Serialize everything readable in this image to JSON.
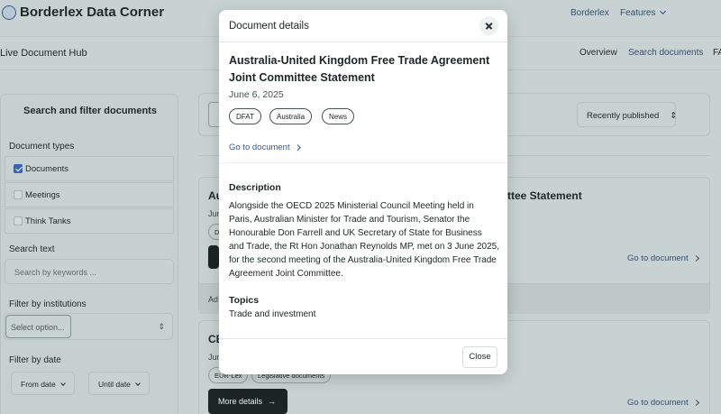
{
  "app": {
    "brand": "Borderlex Data Corner"
  },
  "topnav": {
    "link_borderlex": "Borderlex",
    "link_features": "Features"
  },
  "hub": {
    "title": "Live Document Hub",
    "overview": "Overview",
    "search_documents": "Search documents",
    "fa": "FA"
  },
  "sidebar": {
    "heading": "Search and filter documents",
    "types_label": "Document types",
    "types": [
      {
        "label": "Documents",
        "checked": true
      },
      {
        "label": "Meetings",
        "checked": false
      },
      {
        "label": "Think Tanks",
        "checked": false
      }
    ],
    "search_label": "Search text",
    "search_placeholder": "Search by keywords ...",
    "institutions_label": "Filter by institutions",
    "institutions_placeholder": "Select option...",
    "date_label": "Filter by date",
    "from_date": "From date",
    "until_date": "Until date"
  },
  "results": {
    "sort_label": "Recently published",
    "card1": {
      "title_start": "Au",
      "title_end": "ttee Statement",
      "date_start": "Jun",
      "tag_start": "D",
      "footer_start": "Ad",
      "goto": "Go to document"
    },
    "card2": {
      "title_start": "CE",
      "date_start": "Jun",
      "tags": [
        "EUR-Lex",
        "Legislative documents"
      ],
      "more_details": "More details",
      "goto": "Go to document"
    }
  },
  "modal": {
    "heading": "Document details",
    "title": "Australia-United Kingdom Free Trade Agreement Joint Committee Statement",
    "date": "June 6, 2025",
    "tags": [
      "DFAT",
      "Australia",
      "News"
    ],
    "goto": "Go to document",
    "description_heading": "Description",
    "description": "Alongside the OECD 2025 Ministerial Council Meeting held in Paris, Australian Minister for Trade and Tourism, Senator the Honourable Don Farrell and UK Secretary of State for Business and Trade, the Rt Hon Jonathan Reynolds MP, met on 3 June 2025, for the second meeting of the Australia-United Kingdom Free Trade Agreement Joint Committee.",
    "topics_heading": "Topics",
    "topics": "Trade and investment",
    "close_label": "Close"
  },
  "colors": {
    "overlay": "#c9d2d2",
    "link_blue": "#2f5b9a",
    "checkbox_blue": "#3a63b0",
    "dark_button": "#1d2424"
  }
}
